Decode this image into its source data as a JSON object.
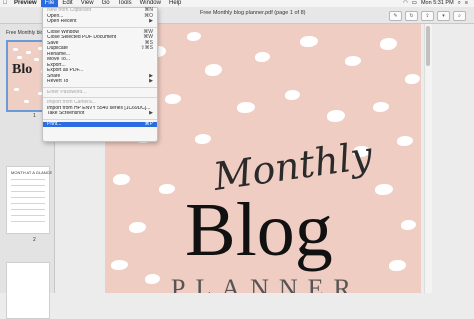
{
  "menubar": {
    "apple": "",
    "items": [
      "Preview",
      "File",
      "Edit",
      "View",
      "Go",
      "Tools",
      "Window",
      "Help"
    ],
    "right": [
      "Mon 5:31 PM"
    ]
  },
  "window": {
    "title": "Free Monthly blog planner.pdf (page 1 of 8)"
  },
  "sidebar": {
    "header": "Free Monthly blo...",
    "thumb1_text": "Blo",
    "pages": [
      "1",
      "2"
    ],
    "thumb2_title": "MONTH AT A GLANCE"
  },
  "file_menu": {
    "items": [
      {
        "label": "New from Clipboard",
        "shortcut": "⌘N",
        "disabled": true
      },
      {
        "label": "Open...",
        "shortcut": "⌘O",
        "disabled": false
      },
      {
        "label": "Open Recent",
        "shortcut": "▶",
        "disabled": false
      },
      {
        "sep": true
      },
      {
        "label": "Close Window",
        "shortcut": "⌘W",
        "disabled": false
      },
      {
        "label": "Close Selected PDF Document",
        "shortcut": "⌘W",
        "disabled": false
      },
      {
        "label": "Save",
        "shortcut": "⌘S",
        "disabled": false
      },
      {
        "label": "Duplicate",
        "shortcut": "⇧⌘S",
        "disabled": false
      },
      {
        "label": "Rename...",
        "shortcut": "",
        "disabled": false
      },
      {
        "label": "Move To...",
        "shortcut": "",
        "disabled": false
      },
      {
        "label": "Export...",
        "shortcut": "",
        "disabled": false
      },
      {
        "label": "Export as PDF...",
        "shortcut": "",
        "disabled": false
      },
      {
        "label": "Share",
        "shortcut": "▶",
        "disabled": false
      },
      {
        "label": "Revert To",
        "shortcut": "▶",
        "disabled": false
      },
      {
        "sep": true
      },
      {
        "label": "Enter Password...",
        "shortcut": "",
        "disabled": true
      },
      {
        "sep": true
      },
      {
        "label": "Import from Camera...",
        "shortcut": "",
        "disabled": true
      },
      {
        "label": "Import from HP ENVY 5540 series [1C69DC]...",
        "shortcut": "",
        "disabled": false
      },
      {
        "label": "Take Screenshot",
        "shortcut": "▶",
        "disabled": false
      },
      {
        "sep": true
      },
      {
        "label": "Print...",
        "shortcut": "⌘P",
        "disabled": false,
        "highlight": true
      }
    ]
  },
  "document": {
    "line1": "Monthly",
    "line2": "Blog",
    "line3": "PLANNER"
  }
}
